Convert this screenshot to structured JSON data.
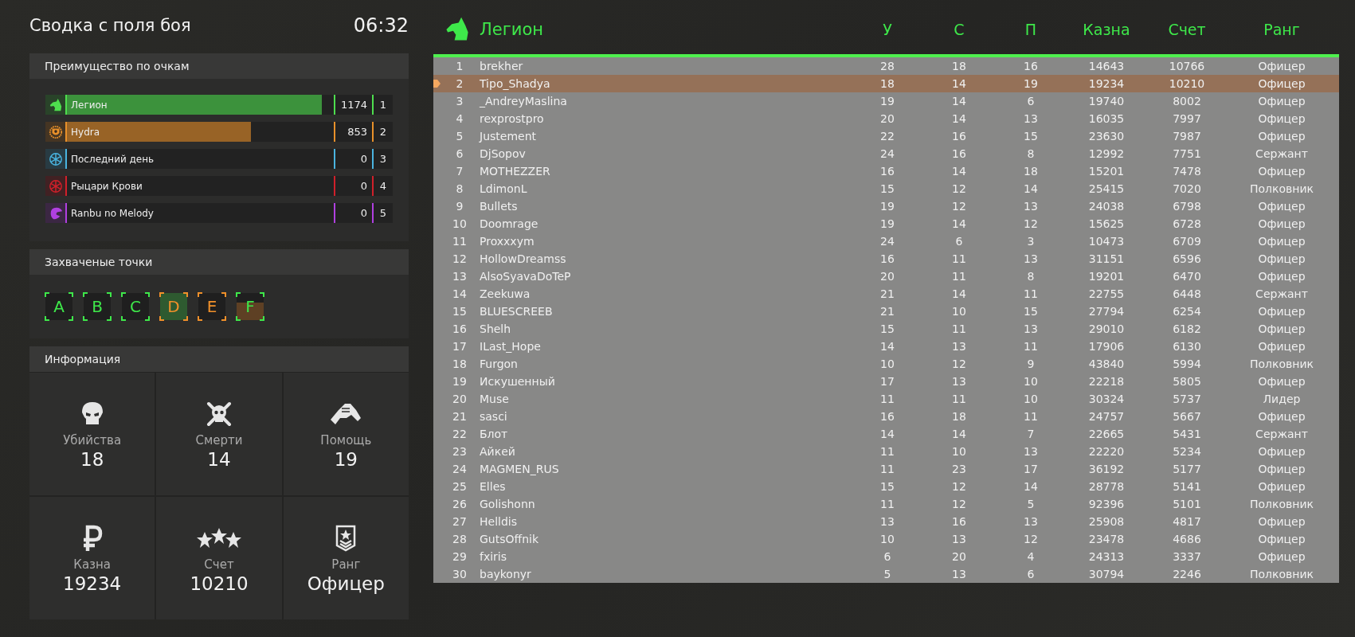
{
  "header": {
    "title": "Сводка с поля боя",
    "time": "06:32"
  },
  "score_panel": {
    "title": "Преимущество по очкам",
    "factions": [
      {
        "kind": "wolf",
        "name": "Легион",
        "score": "1174",
        "place": "1",
        "color": "#4ede4e",
        "level": 0.955
      },
      {
        "kind": "shield",
        "name": "Hydra",
        "score": "853",
        "place": "2",
        "color": "#e8902a",
        "level": 0.69
      },
      {
        "kind": "wheel",
        "name": "Последний день",
        "score": "0",
        "place": "3",
        "color": "#4ab4e0"
      },
      {
        "kind": "wheel",
        "name": "Рыцари Крови",
        "score": "0",
        "place": "4",
        "color": "#d0202a"
      },
      {
        "kind": "bird",
        "name": "Ranbu no Melody",
        "score": "0",
        "place": "5",
        "color": "#b040e0"
      }
    ]
  },
  "points_panel": {
    "title": "Захваченые точки",
    "points": [
      {
        "label": "A",
        "color": "#3ee84a",
        "held": false,
        "contested": false
      },
      {
        "label": "B",
        "color": "#3ee84a",
        "held": false,
        "contested": false
      },
      {
        "label": "C",
        "color": "#3ee84a",
        "held": false,
        "contested": false
      },
      {
        "label": "D",
        "color": "#f0902a",
        "held": true,
        "contested": false
      },
      {
        "label": "E",
        "color": "#f0902a",
        "held": false,
        "contested": false
      },
      {
        "label": "F",
        "color": "#3ee84a",
        "held": false,
        "contested": true
      }
    ]
  },
  "info_panel": {
    "title": "Информация",
    "stats": [
      {
        "kind": "skull",
        "label": "Убийства",
        "value": "18"
      },
      {
        "kind": "crossbones",
        "label": "Смерти",
        "value": "14"
      },
      {
        "kind": "hands",
        "label": "Помощь",
        "value": "19"
      },
      {
        "kind": "ruble",
        "label": "Казна",
        "value": "19234"
      },
      {
        "kind": "stars",
        "label": "Счет",
        "value": "10210"
      },
      {
        "kind": "badge",
        "label": "Ранг",
        "value": "Офицер"
      }
    ]
  },
  "roster": {
    "columns": [
      "",
      "Легион",
      "У",
      "С",
      "П",
      "Казна",
      "Счет",
      "Ранг"
    ],
    "rows": [
      {
        "cells": [
          "1",
          "brekher",
          "28",
          "18",
          "16",
          "14643",
          "10766",
          "Офицер"
        ],
        "selected": false
      },
      {
        "cells": [
          "2",
          "Tipo_Shadya",
          "18",
          "14",
          "19",
          "19234",
          "10210",
          "Офицер"
        ],
        "selected": true
      },
      {
        "cells": [
          "3",
          "_AndreyMaslina",
          "19",
          "14",
          "6",
          "19740",
          "8002",
          "Офицер"
        ],
        "selected": false
      },
      {
        "cells": [
          "4",
          "rexprostpro",
          "20",
          "14",
          "13",
          "16035",
          "7997",
          "Офицер"
        ],
        "selected": false
      },
      {
        "cells": [
          "5",
          "Justement",
          "22",
          "16",
          "15",
          "23630",
          "7987",
          "Офицер"
        ],
        "selected": false
      },
      {
        "cells": [
          "6",
          "DjSopov",
          "24",
          "16",
          "8",
          "12992",
          "7751",
          "Сержант"
        ],
        "selected": false
      },
      {
        "cells": [
          "7",
          "MOTHEZZER",
          "16",
          "14",
          "18",
          "15201",
          "7478",
          "Офицер"
        ],
        "selected": false
      },
      {
        "cells": [
          "8",
          "LdimonL",
          "15",
          "12",
          "14",
          "25415",
          "7020",
          "Полковник"
        ],
        "selected": false
      },
      {
        "cells": [
          "9",
          "Bullets",
          "19",
          "12",
          "13",
          "24038",
          "6798",
          "Офицер"
        ],
        "selected": false
      },
      {
        "cells": [
          "10",
          "Doomrage",
          "19",
          "14",
          "12",
          "15625",
          "6728",
          "Офицер"
        ],
        "selected": false
      },
      {
        "cells": [
          "11",
          "Proxxxym",
          "24",
          "6",
          "3",
          "10473",
          "6709",
          "Офицер"
        ],
        "selected": false
      },
      {
        "cells": [
          "12",
          "HollowDreamss",
          "16",
          "11",
          "13",
          "31151",
          "6596",
          "Офицер"
        ],
        "selected": false
      },
      {
        "cells": [
          "13",
          "AlsoSyavaDoTeP",
          "20",
          "11",
          "8",
          "19201",
          "6470",
          "Офицер"
        ],
        "selected": false
      },
      {
        "cells": [
          "14",
          "Zeekuwa",
          "21",
          "14",
          "11",
          "22755",
          "6448",
          "Сержант"
        ],
        "selected": false
      },
      {
        "cells": [
          "15",
          "BLUESCREEB",
          "21",
          "10",
          "15",
          "27794",
          "6254",
          "Офицер"
        ],
        "selected": false
      },
      {
        "cells": [
          "16",
          "Shelh",
          "15",
          "11",
          "13",
          "29010",
          "6182",
          "Офицер"
        ],
        "selected": false
      },
      {
        "cells": [
          "17",
          "ILast_Hope",
          "14",
          "13",
          "11",
          "17906",
          "6130",
          "Офицер"
        ],
        "selected": false
      },
      {
        "cells": [
          "18",
          "Furgon",
          "10",
          "12",
          "9",
          "43840",
          "5994",
          "Полковник"
        ],
        "selected": false
      },
      {
        "cells": [
          "19",
          "Искушенный",
          "17",
          "13",
          "10",
          "22218",
          "5805",
          "Офицер"
        ],
        "selected": false
      },
      {
        "cells": [
          "20",
          "Muse",
          "11",
          "11",
          "10",
          "30324",
          "5737",
          "Лидер"
        ],
        "selected": false
      },
      {
        "cells": [
          "21",
          "sasci",
          "16",
          "18",
          "11",
          "24757",
          "5667",
          "Офицер"
        ],
        "selected": false
      },
      {
        "cells": [
          "22",
          "Блот",
          "14",
          "14",
          "7",
          "22665",
          "5431",
          "Сержант"
        ],
        "selected": false
      },
      {
        "cells": [
          "23",
          "Айкей",
          "11",
          "10",
          "13",
          "22220",
          "5234",
          "Офицер"
        ],
        "selected": false
      },
      {
        "cells": [
          "24",
          "MAGMEN_RUS",
          "11",
          "23",
          "17",
          "36192",
          "5177",
          "Офицер"
        ],
        "selected": false
      },
      {
        "cells": [
          "25",
          "Elles",
          "15",
          "12",
          "14",
          "28778",
          "5141",
          "Офицер"
        ],
        "selected": false
      },
      {
        "cells": [
          "26",
          "Golishonn",
          "11",
          "12",
          "5",
          "92396",
          "5101",
          "Полковник"
        ],
        "selected": false
      },
      {
        "cells": [
          "27",
          "Helldis",
          "13",
          "16",
          "13",
          "25908",
          "4817",
          "Офицер"
        ],
        "selected": false
      },
      {
        "cells": [
          "28",
          "GutsOffnik",
          "10",
          "13",
          "12",
          "23478",
          "4686",
          "Офицер"
        ],
        "selected": false
      },
      {
        "cells": [
          "29",
          "fxiris",
          "6",
          "20",
          "4",
          "24313",
          "3337",
          "Офицер"
        ],
        "selected": false
      },
      {
        "cells": [
          "30",
          "baykonyr",
          "5",
          "13",
          "6",
          "30794",
          "2246",
          "Полковник"
        ],
        "selected": false
      }
    ]
  }
}
